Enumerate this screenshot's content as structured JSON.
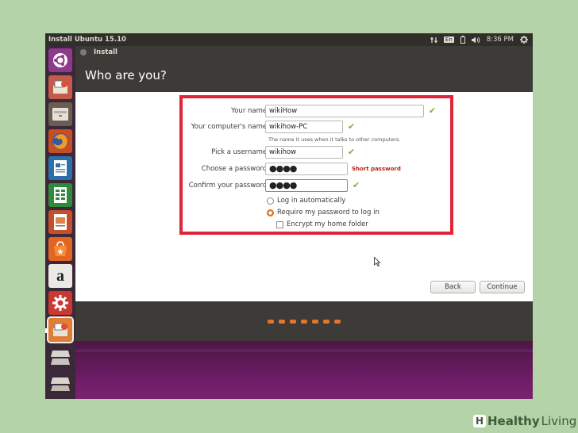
{
  "top_panel": {
    "title": "Install Ubuntu 15.10",
    "language": "En",
    "time": "8:36 PM"
  },
  "launcher": {
    "items": [
      "ubuntu-dash-icon",
      "installer-icon",
      "files-icon",
      "firefox-icon",
      "writer-icon",
      "calc-icon",
      "impress-icon",
      "software-center-icon",
      "amazon-icon",
      "settings-icon",
      "install-ubuntu-icon",
      "trash-icon"
    ],
    "amazon_glyph": "a"
  },
  "window": {
    "title": "Install",
    "header": "Who are you?"
  },
  "form": {
    "name_label": "Your name:",
    "name_value": "wikiHow",
    "computer_label": "Your computer's name:",
    "computer_value": "wikihow-PC",
    "computer_hint": "The name it uses when it talks to other computers.",
    "username_label": "Pick a username:",
    "username_value": "wikihow",
    "password_label": "Choose a password:",
    "password_value": "●●●●",
    "password_warning": "Short password",
    "confirm_label": "Confirm your password:",
    "confirm_value": "●●●●",
    "login_auto": "Log in automatically",
    "require_password": "Require my password to log in",
    "encrypt_home": "Encrypt my home folder",
    "login_mode": "require_password",
    "encrypt_checked": false
  },
  "buttons": {
    "back": "Back",
    "continue": "Continue"
  },
  "progress": {
    "dots": 7
  },
  "watermark": {
    "glyph": "H",
    "word1": "Healthy",
    "word2": " Living"
  },
  "colors": {
    "accent": "#e0711b",
    "highlight_box": "#e0243a",
    "check": "#7cb342",
    "warning": "#b3221a"
  }
}
